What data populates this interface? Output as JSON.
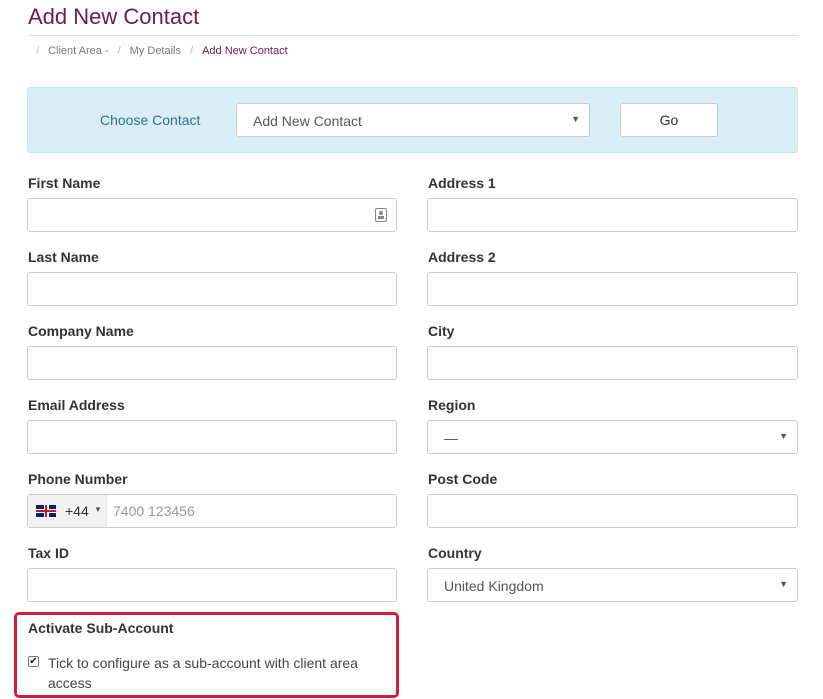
{
  "page": {
    "title": "Add New Contact"
  },
  "breadcrumb": {
    "items": [
      "Client Area -",
      "My Details",
      "Add New Contact"
    ]
  },
  "choose_contact": {
    "label": "Choose Contact",
    "selected": "Add New Contact",
    "go_label": "Go"
  },
  "form": {
    "first_name": {
      "label": "First Name",
      "value": ""
    },
    "last_name": {
      "label": "Last Name",
      "value": ""
    },
    "company_name": {
      "label": "Company Name",
      "value": ""
    },
    "email_address": {
      "label": "Email Address",
      "value": ""
    },
    "phone_number": {
      "label": "Phone Number",
      "dial_code": "+44",
      "placeholder": "7400 123456",
      "country_flag": "uk-flag-icon"
    },
    "tax_id": {
      "label": "Tax ID",
      "value": ""
    },
    "address_1": {
      "label": "Address 1",
      "value": ""
    },
    "address_2": {
      "label": "Address 2",
      "value": ""
    },
    "city": {
      "label": "City",
      "value": ""
    },
    "region": {
      "label": "Region",
      "selected": "—"
    },
    "post_code": {
      "label": "Post Code",
      "value": ""
    },
    "country": {
      "label": "Country",
      "selected": "United Kingdom"
    }
  },
  "sub_account": {
    "title": "Activate Sub-Account",
    "checked": true,
    "checkbox_label": "Tick to configure as a sub-account with client area access"
  },
  "colors": {
    "brand": "#6b1f3f",
    "panel_bg": "#d9edf7",
    "panel_text": "#31708f",
    "highlight_border": "#d01f3c"
  }
}
